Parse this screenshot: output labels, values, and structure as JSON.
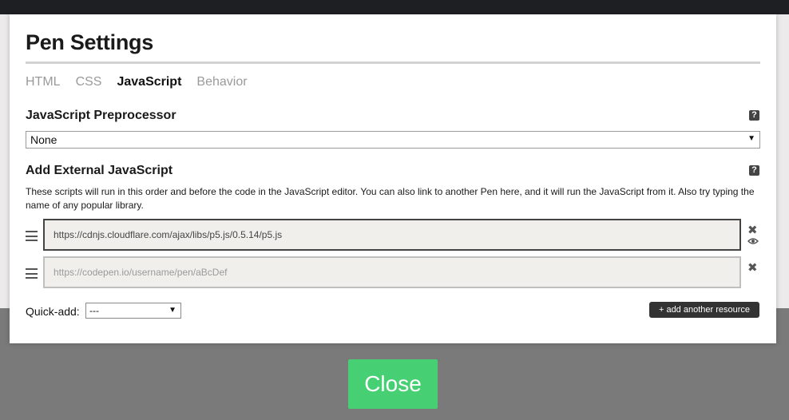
{
  "modal": {
    "title": "Pen Settings",
    "tabs": [
      {
        "label": "HTML",
        "active": false
      },
      {
        "label": "CSS",
        "active": false
      },
      {
        "label": "JavaScript",
        "active": true
      },
      {
        "label": "Behavior",
        "active": false
      }
    ],
    "preprocessor": {
      "label": "JavaScript Preprocessor",
      "help": "?",
      "selected": "None",
      "arrow": "▼"
    },
    "external": {
      "label": "Add External JavaScript",
      "help": "?",
      "description": "These scripts will run in this order and before the code in the JavaScript editor. You can also link to another Pen here, and it will run the JavaScript from it. Also try typing the name of any popular library.",
      "resources": [
        {
          "value": "https://cdnjs.cloudflare.com/ajax/libs/p5.js/0.5.14/p5.js",
          "placeholder": ""
        },
        {
          "value": "",
          "placeholder": "https://codepen.io/username/pen/aBcDef"
        }
      ],
      "remove_icon": "✖"
    },
    "quick_add": {
      "label": "Quick-add:",
      "selected": "---",
      "arrow": "▼"
    },
    "add_resource_label": "+ add another resource"
  },
  "close_label": "Close",
  "colors": {
    "accent": "#47cf73",
    "dark": "#333333",
    "input_bg": "#f1efeb"
  }
}
